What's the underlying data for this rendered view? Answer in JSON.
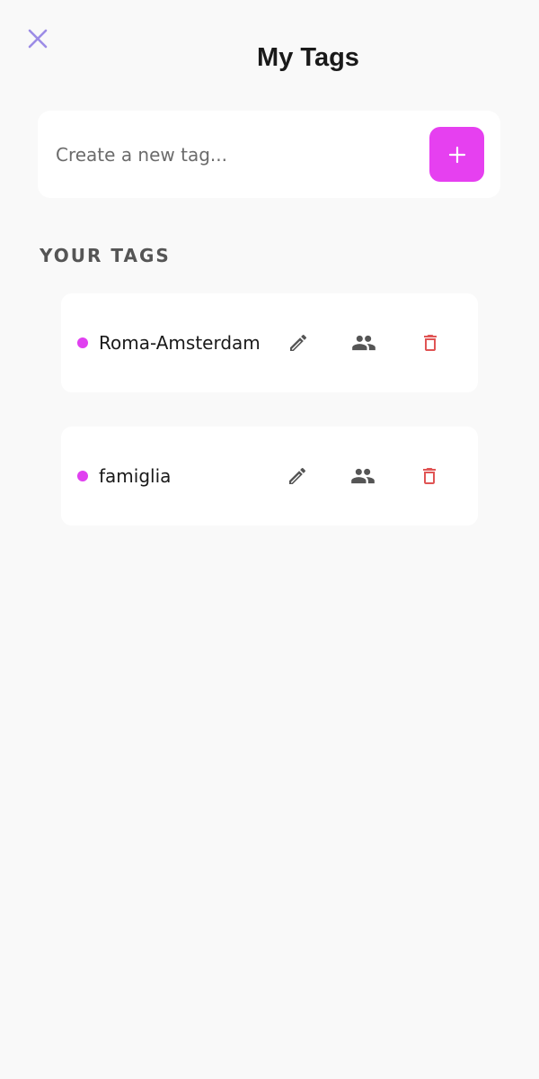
{
  "header": {
    "title": "My Tags",
    "close_icon": "close-icon"
  },
  "create": {
    "placeholder": "Create a new tag...",
    "value": "",
    "add_icon": "plus-icon"
  },
  "section": {
    "label": "YOUR TAGS"
  },
  "tags": [
    {
      "name": "Roma-Amsterdam",
      "color": "#e040f0"
    },
    {
      "name": "famiglia",
      "color": "#e040f0"
    }
  ],
  "colors": {
    "accent": "#e640f0",
    "close": "#9c8ce6",
    "delete": "#e05555",
    "icon": "#555555"
  }
}
